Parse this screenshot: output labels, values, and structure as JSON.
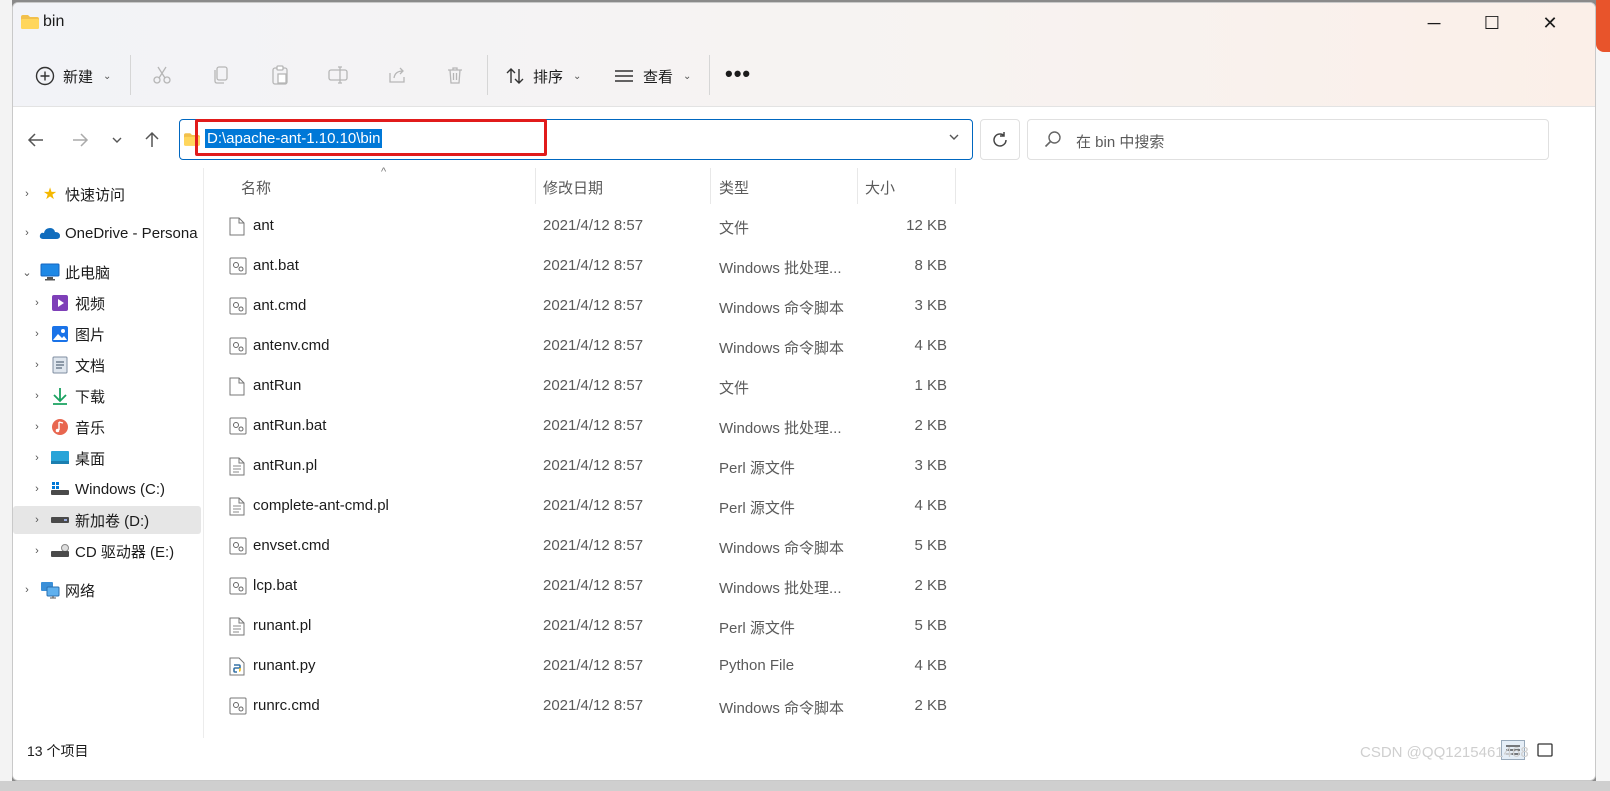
{
  "window": {
    "title": "bin",
    "controls": {
      "minimize": "─",
      "maximize": "☐",
      "close": "✕"
    }
  },
  "command_bar": {
    "new_label": "新建",
    "sort_label": "排序",
    "view_label": "查看",
    "more_label": "•••",
    "icons": [
      "cut-icon",
      "copy-icon",
      "paste-icon",
      "rename-icon",
      "share-icon",
      "delete-icon"
    ]
  },
  "navigation": {
    "address_path": "D:\\apache-ant-1.10.10\\bin",
    "search_placeholder": "在 bin 中搜索"
  },
  "sidebar": {
    "items": [
      {
        "label": "快速访问",
        "icon": "star-icon"
      },
      {
        "label": "OneDrive - Persona",
        "icon": "cloud-icon"
      },
      {
        "label": "此电脑",
        "icon": "computer-icon"
      },
      {
        "label": "视频",
        "icon": "video-icon"
      },
      {
        "label": "图片",
        "icon": "picture-icon"
      },
      {
        "label": "文档",
        "icon": "document-icon"
      },
      {
        "label": "下载",
        "icon": "download-icon"
      },
      {
        "label": "音乐",
        "icon": "music-icon"
      },
      {
        "label": "桌面",
        "icon": "desktop-icon"
      },
      {
        "label": "Windows (C:)",
        "icon": "drive-c-icon"
      },
      {
        "label": "新加卷 (D:)",
        "icon": "drive-d-icon"
      },
      {
        "label": "CD 驱动器 (E:)",
        "icon": "cd-drive-icon"
      },
      {
        "label": "网络",
        "icon": "network-icon"
      }
    ]
  },
  "file_list": {
    "columns": [
      "名称",
      "修改日期",
      "类型",
      "大小"
    ],
    "rows": [
      {
        "name": "ant",
        "date": "2021/4/12 8:57",
        "type": "文件",
        "size": "12 KB",
        "icon": "file-icon"
      },
      {
        "name": "ant.bat",
        "date": "2021/4/12 8:57",
        "type": "Windows 批处理...",
        "size": "8 KB",
        "icon": "script-icon"
      },
      {
        "name": "ant.cmd",
        "date": "2021/4/12 8:57",
        "type": "Windows 命令脚本",
        "size": "3 KB",
        "icon": "script-icon"
      },
      {
        "name": "antenv.cmd",
        "date": "2021/4/12 8:57",
        "type": "Windows 命令脚本",
        "size": "4 KB",
        "icon": "script-icon"
      },
      {
        "name": "antRun",
        "date": "2021/4/12 8:57",
        "type": "文件",
        "size": "1 KB",
        "icon": "file-icon"
      },
      {
        "name": "antRun.bat",
        "date": "2021/4/12 8:57",
        "type": "Windows 批处理...",
        "size": "2 KB",
        "icon": "script-icon"
      },
      {
        "name": "antRun.pl",
        "date": "2021/4/12 8:57",
        "type": "Perl 源文件",
        "size": "3 KB",
        "icon": "text-file-icon"
      },
      {
        "name": "complete-ant-cmd.pl",
        "date": "2021/4/12 8:57",
        "type": "Perl 源文件",
        "size": "4 KB",
        "icon": "text-file-icon"
      },
      {
        "name": "envset.cmd",
        "date": "2021/4/12 8:57",
        "type": "Windows 命令脚本",
        "size": "5 KB",
        "icon": "script-icon"
      },
      {
        "name": "lcp.bat",
        "date": "2021/4/12 8:57",
        "type": "Windows 批处理...",
        "size": "2 KB",
        "icon": "script-icon"
      },
      {
        "name": "runant.pl",
        "date": "2021/4/12 8:57",
        "type": "Perl 源文件",
        "size": "5 KB",
        "icon": "text-file-icon"
      },
      {
        "name": "runant.py",
        "date": "2021/4/12 8:57",
        "type": "Python File",
        "size": "4 KB",
        "icon": "python-file-icon"
      },
      {
        "name": "runrc.cmd",
        "date": "2021/4/12 8:57",
        "type": "Windows 命令脚本",
        "size": "2 KB",
        "icon": "script-icon"
      }
    ]
  },
  "status_bar": {
    "item_count": "13 个项目",
    "watermark": "CSDN @QQ1215461468"
  },
  "colors": {
    "accent": "#0078d7",
    "highlight_box": "#e11b1b",
    "selected_bg": "#e6e6e6"
  }
}
